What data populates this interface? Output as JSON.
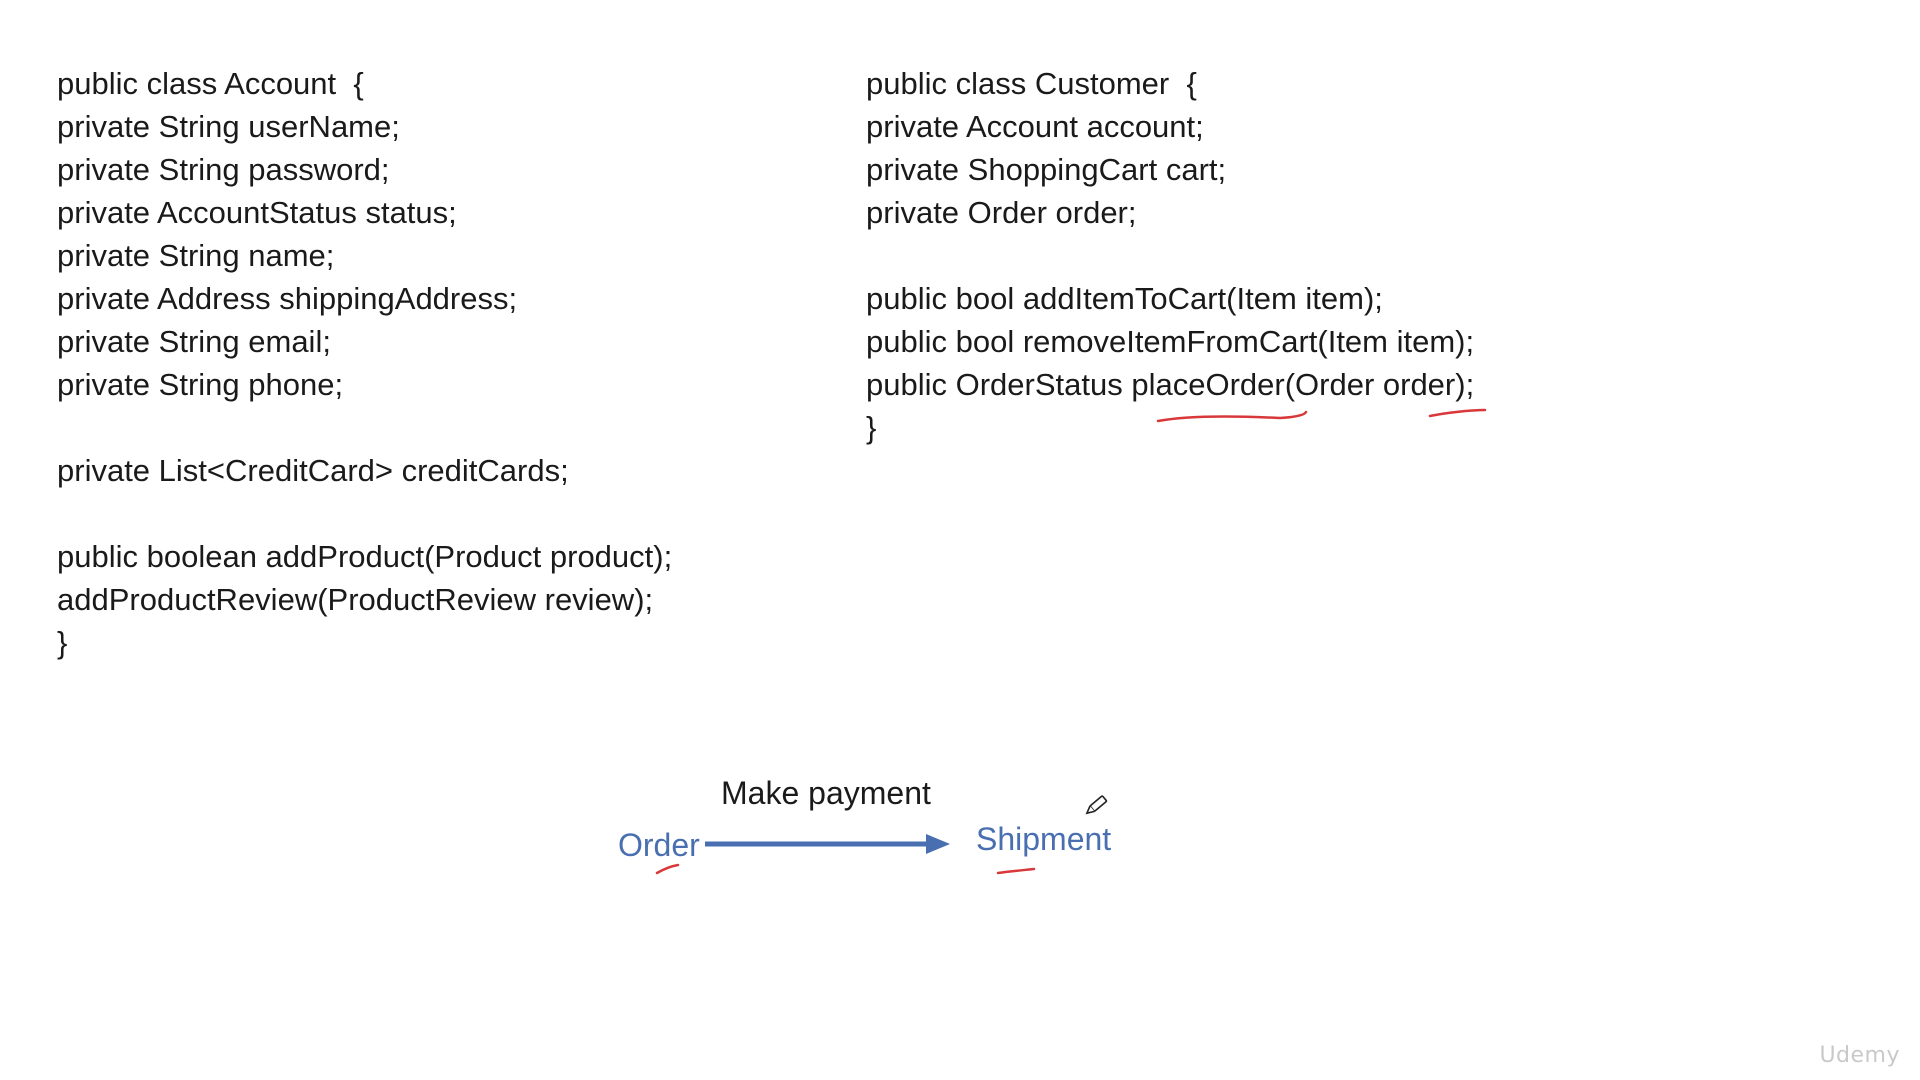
{
  "account_class": {
    "lines": [
      "public class Account  {",
      "private String userName;",
      "private String password;",
      "private AccountStatus status;",
      "private String name;",
      "private Address shippingAddress;",
      "private String email;",
      "private String phone;",
      "",
      "private List<CreditCard> creditCards;",
      "",
      "public boolean addProduct(Product product);",
      "addProductReview(ProductReview review);",
      "}"
    ]
  },
  "customer_class": {
    "lines": [
      "public class Customer  {",
      "private Account account;",
      "private ShoppingCart cart;",
      "private Order order;",
      "",
      "public bool addItemToCart(Item item);",
      "public bool removeItemFromCart(Item item);",
      "public OrderStatus placeOrder(Order order);",
      "}"
    ]
  },
  "flow": {
    "edge_label": "Make payment",
    "source": "Order",
    "target": "Shipment"
  },
  "colors": {
    "code_text": "#1a1a1a",
    "flow_blue": "#4a6fb0",
    "annotation_red": "#d9383a"
  },
  "watermark": "Udemy"
}
